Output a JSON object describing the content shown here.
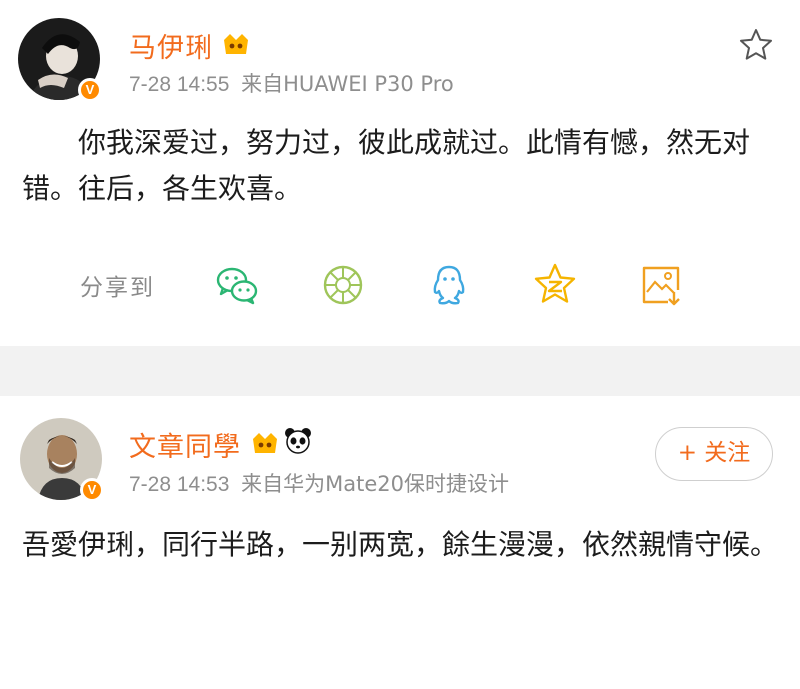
{
  "posts": [
    {
      "author": "马伊琍",
      "time": "7-28 14:55",
      "source": "来自HUAWEI P30 Pro",
      "text": "你我深爱过，努力过，彼此成就过。此情有憾，然无对错。往后，各生欢喜。",
      "share_label": "分享到",
      "share_targets": [
        {
          "name": "wechat",
          "icon": "wechat-icon"
        },
        {
          "name": "moments",
          "icon": "moments-icon"
        },
        {
          "name": "qq",
          "icon": "qq-icon"
        },
        {
          "name": "qzone",
          "icon": "qzone-icon"
        },
        {
          "name": "save-image",
          "icon": "save-image-icon"
        }
      ],
      "badge": "V"
    },
    {
      "author": "文章同學",
      "time": "7-28 14:53",
      "source": "来自华为Mate20保时捷设计",
      "text": "吾愛伊琍，同行半路，一别两宽，餘生漫漫，依然親情守候。",
      "follow_label": "+ 关注",
      "badge": "V"
    }
  ],
  "colors": {
    "accent": "#f26b1d",
    "meta": "#8e8e8e",
    "badge": "#ff8a00",
    "background": "#f2f2f2"
  }
}
